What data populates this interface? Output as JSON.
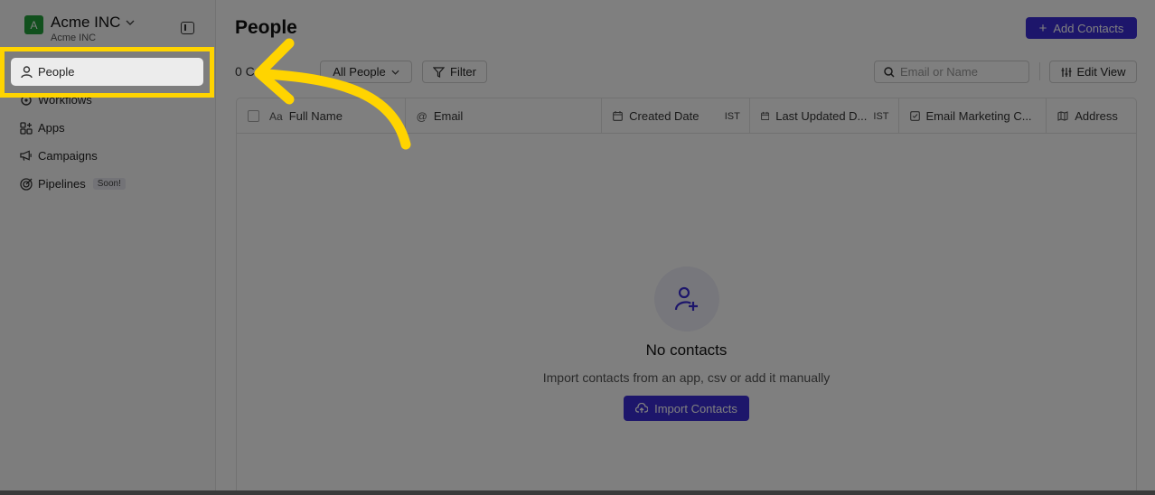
{
  "workspace": {
    "initial": "A",
    "name": "Acme INC",
    "sub": "Acme INC"
  },
  "sidebar": {
    "items": [
      {
        "label": "People",
        "icon": "person-icon"
      },
      {
        "label": "Workflows",
        "icon": "workflow-icon"
      },
      {
        "label": "Apps",
        "icon": "apps-icon"
      },
      {
        "label": "Campaigns",
        "icon": "megaphone-icon"
      },
      {
        "label": "Pipelines",
        "icon": "target-icon",
        "badge": "Soon!"
      }
    ]
  },
  "header": {
    "title": "People",
    "add_label": "Add Contacts"
  },
  "toolbar": {
    "count_text": "0 C",
    "view_label": "All People",
    "filter_label": "Filter",
    "search_placeholder": "Email or Name",
    "edit_view_label": "Edit View"
  },
  "table": {
    "columns": [
      {
        "label": "Full Name",
        "icon": "Aa"
      },
      {
        "label": "Email",
        "icon": "@"
      },
      {
        "label": "Created Date",
        "icon": "calendar",
        "tz": "IST"
      },
      {
        "label": "Last Updated D...",
        "icon": "calendar",
        "tz": "IST"
      },
      {
        "label": "Email Marketing C...",
        "icon": "check"
      },
      {
        "label": "Address",
        "icon": "map"
      }
    ]
  },
  "empty": {
    "title": "No contacts",
    "subtitle": "Import contacts from an app, csv or add it manually",
    "import_label": "Import Contacts"
  },
  "colors": {
    "accent": "#3b2dd6",
    "highlight": "#ffd400",
    "workspace": "#22a03a"
  }
}
